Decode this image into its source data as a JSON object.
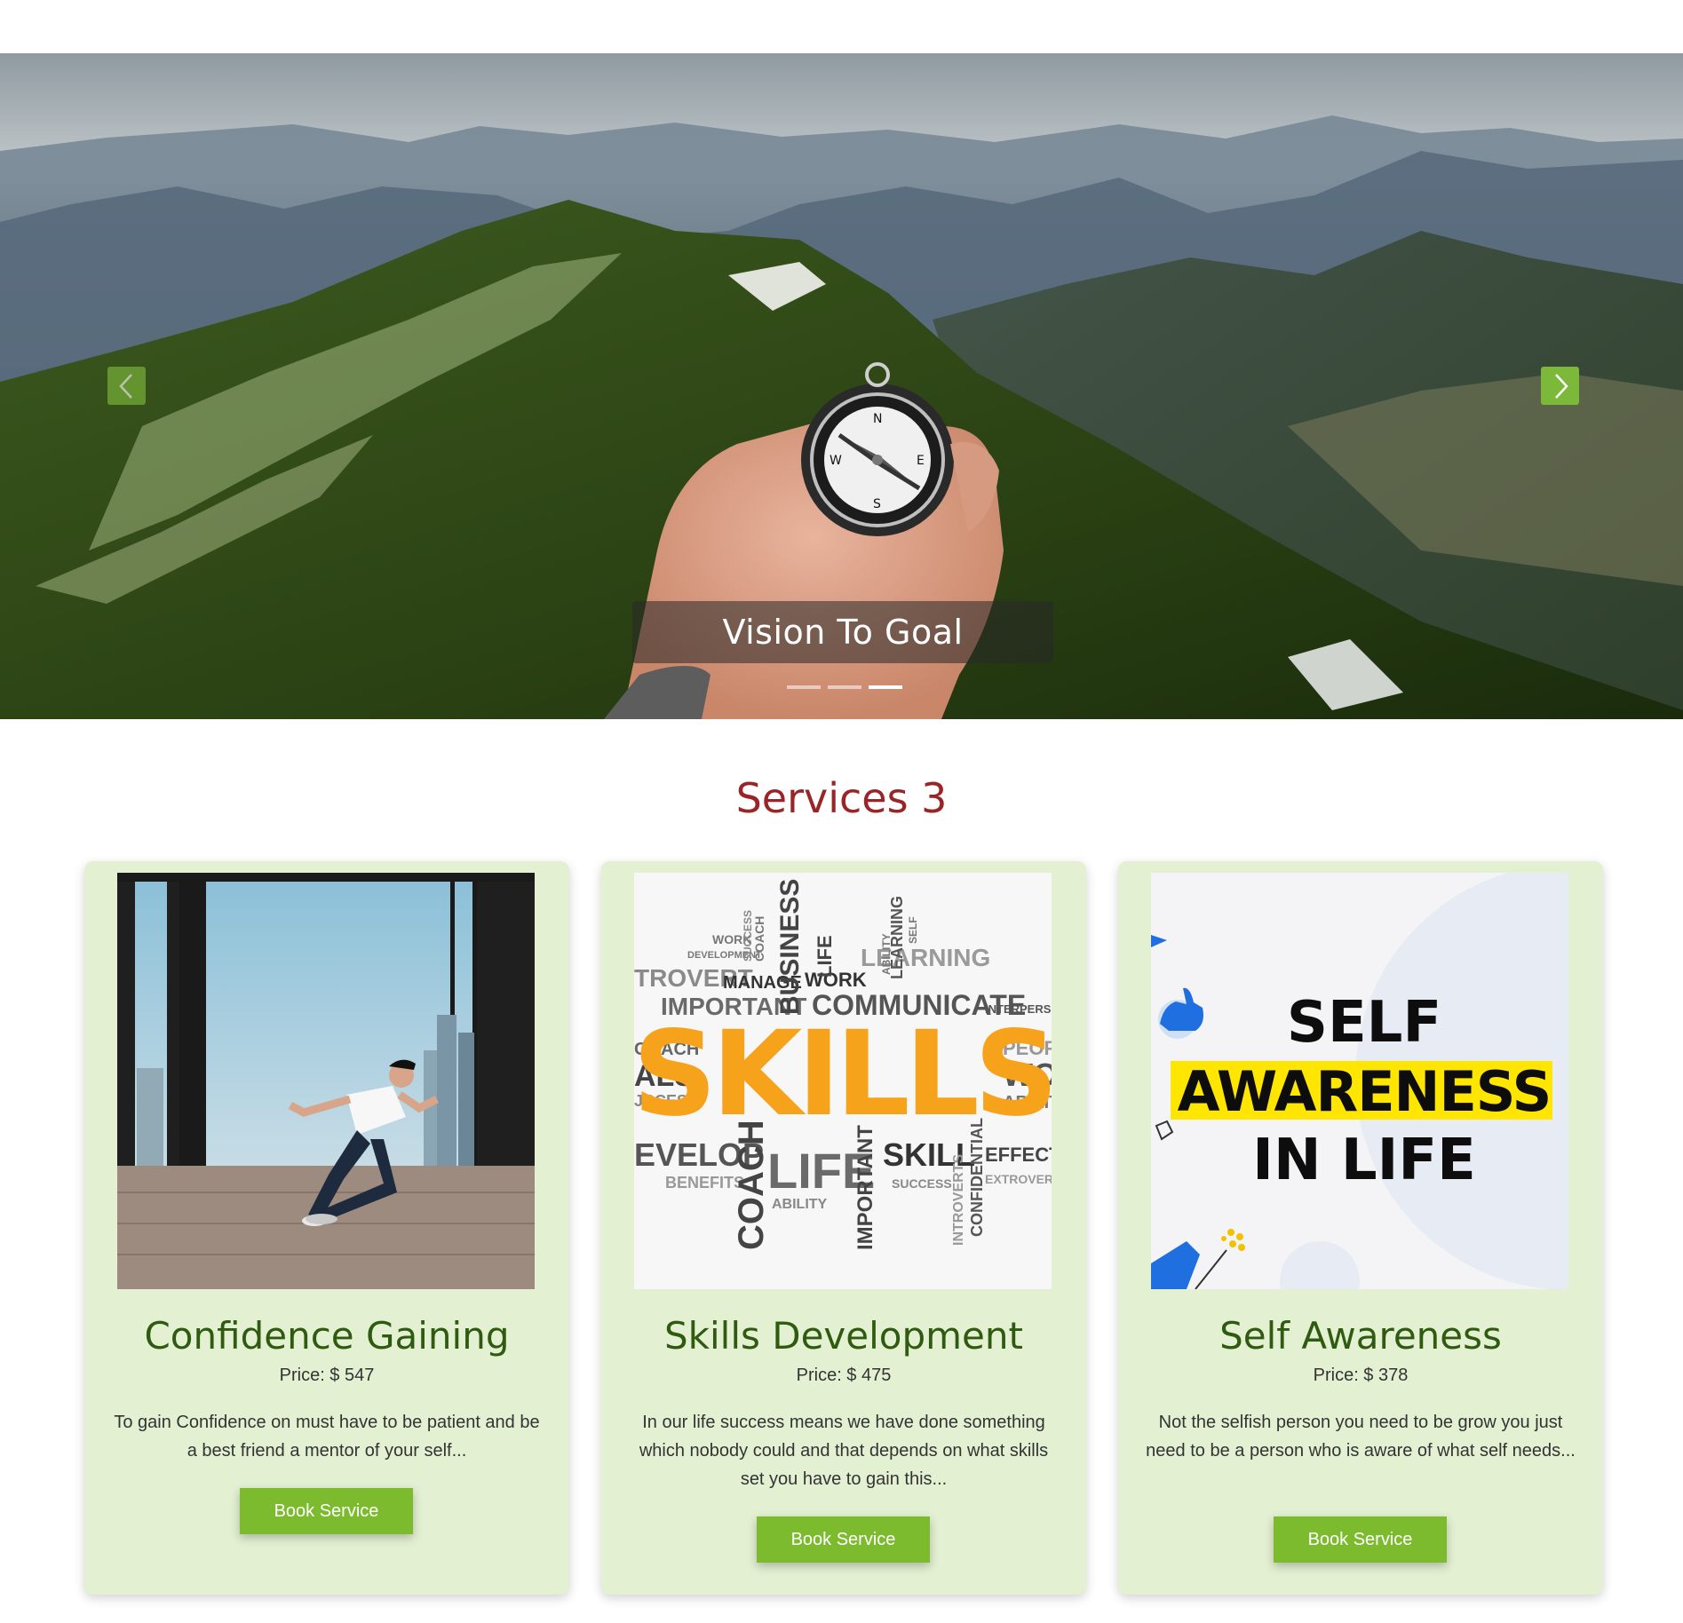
{
  "hero": {
    "caption": "Vision To Goal",
    "slides": [
      "slide-1",
      "slide-2",
      "slide-3"
    ],
    "active_slide": 3,
    "accent": "#7cb83a"
  },
  "services": {
    "title": "Services 3",
    "title_color": "#9b2426",
    "cards": [
      {
        "title": "Confidence Gaining",
        "price": "Price: $ 547",
        "description": "To gain Confidence on must have to be patient and be a best friend a mentor of your self...",
        "button": "Book Service"
      },
      {
        "title": "Skills Development",
        "price": "Price: $ 475",
        "description": "In our life success means we have done something which nobody could and that depends on what skills set you have to gain this...",
        "button": "Book Service",
        "image_text": {
          "main": "SKILLS",
          "words": [
            "WORK",
            "DEVELOPMENT",
            "SUCCESS",
            "COACH",
            "BUSINESS",
            "LIFE",
            "LEARNING",
            "ABILITY",
            "SELF",
            "TROVERT",
            "MANAGE",
            "WORK",
            "SUCCESS",
            "DEVELOPMENT",
            "IMPORTANT",
            "COMMUNICATE",
            "INTERPERSO",
            "COACH",
            "ALS",
            "JCCESS",
            "PEOPL",
            "WOI",
            "ABILIT",
            "EVELOP",
            "COACH",
            "LIFE",
            "SKILL",
            "EFFECTIV",
            "BENEFITS",
            "ABILITY",
            "IMPORTANT",
            "SUCCESS",
            "EXTROVERT",
            "INTROVERTS",
            "CONFIDENTIAL"
          ]
        }
      },
      {
        "title": "Self Awareness",
        "price": "Price: $ 378",
        "description": "Not the selfish person you need to be grow you just need to be a person who is aware of what self needs...",
        "button": "Book Service",
        "image_text": {
          "line1": "SELF",
          "line2": "AWARENESS",
          "line3": "IN LIFE"
        }
      }
    ]
  }
}
